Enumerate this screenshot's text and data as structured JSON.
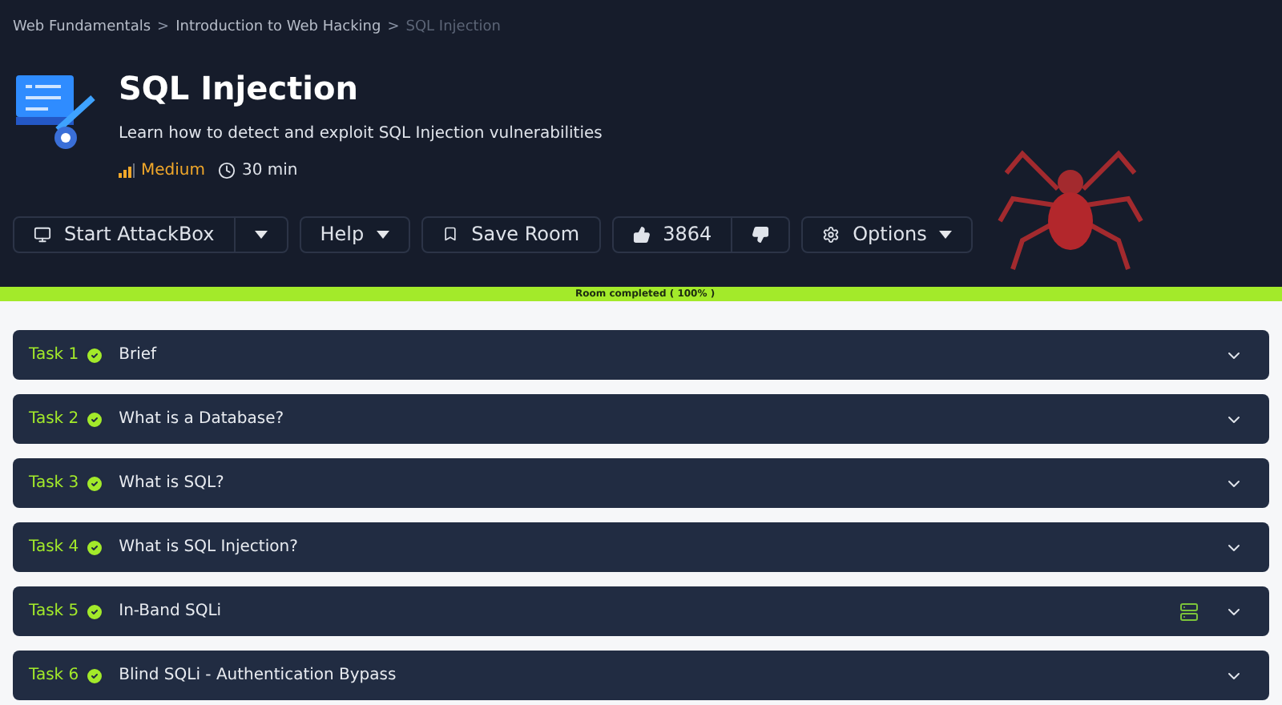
{
  "breadcrumbs": [
    {
      "label": "Web Fundamentals",
      "current": false
    },
    {
      "label": "Introduction to Web Hacking",
      "current": false
    },
    {
      "label": "SQL Injection",
      "current": true
    }
  ],
  "breadcrumb_separator": ">",
  "room": {
    "title": "SQL Injection",
    "description": "Learn how to detect and exploit SQL Injection vulnerabilities",
    "difficulty": "Medium",
    "duration": "30 min"
  },
  "actions": {
    "attackbox": "Start AttackBox",
    "help": "Help",
    "save": "Save Room",
    "likes": "3864",
    "options": "Options"
  },
  "progress": {
    "label": "Room completed ( 100% )",
    "level": 1
  },
  "tasks": [
    {
      "number": "Task 1",
      "title": "Brief",
      "completed": true,
      "has_machine": false
    },
    {
      "number": "Task 2",
      "title": "What is a Database?",
      "completed": true,
      "has_machine": false
    },
    {
      "number": "Task 3",
      "title": "What is SQL?",
      "completed": true,
      "has_machine": false
    },
    {
      "number": "Task 4",
      "title": "What is SQL Injection?",
      "completed": true,
      "has_machine": false
    },
    {
      "number": "Task 5",
      "title": "In-Band SQLi",
      "completed": true,
      "has_machine": true
    },
    {
      "number": "Task 6",
      "title": "Blind SQLi - Authentication Bypass",
      "completed": true,
      "has_machine": false
    }
  ]
}
